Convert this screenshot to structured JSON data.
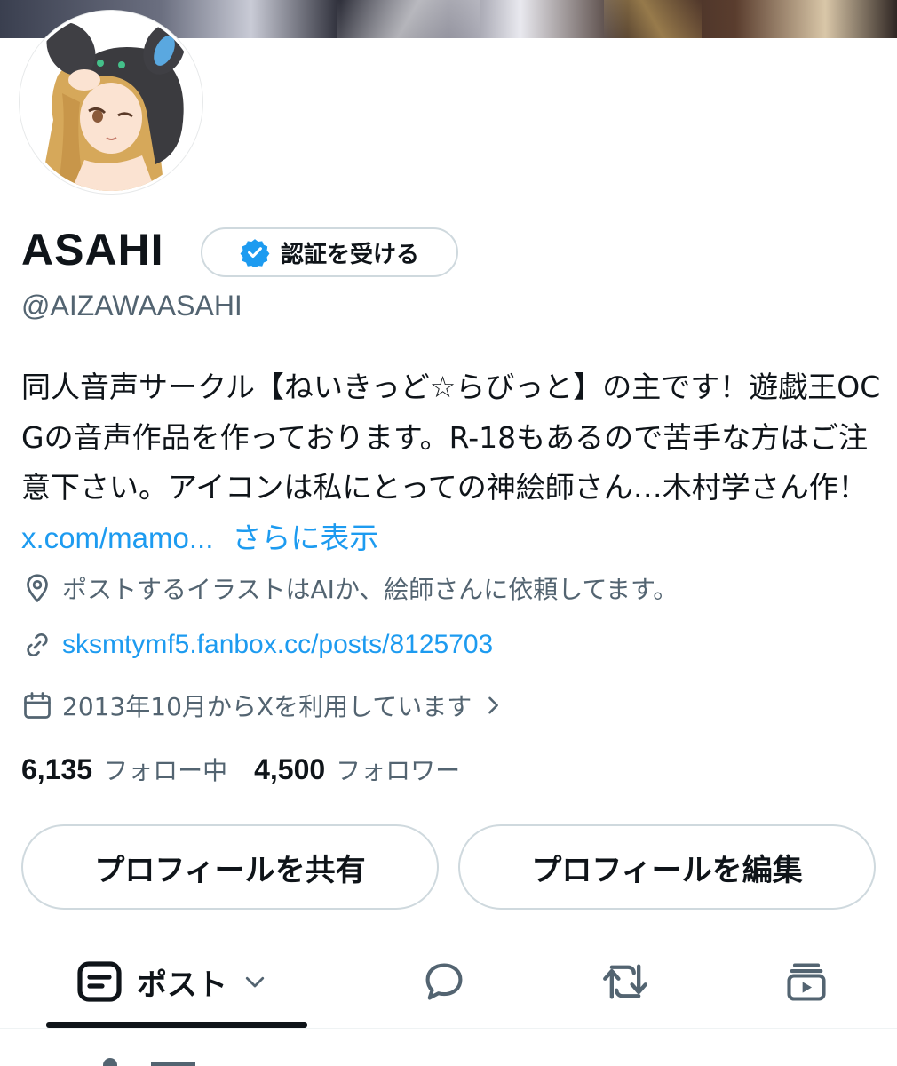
{
  "profile": {
    "name": "ASAHI",
    "handle": "@AIZAWAASAHI",
    "verify_label": "認証を受ける",
    "bio_text": "同人音声サークル【ねいきっど☆らびっと】の主です！遊戯王OCGの音声作品を作っております。R-18もあるので苦手な方はご注意下さい。アイコンは私にとっての神絵師さん…木村学さん作！ ",
    "bio_link": "x.com/mamo...",
    "bio_more": "さらに表示",
    "location": "ポストするイラストはAIか、絵師さんに依頼してます。",
    "website": "sksmtymf5.fanbox.cc/posts/8125703",
    "joined": "2013年10月からXを利用しています",
    "following_count": "6,135",
    "following_label": "フォロー中",
    "followers_count": "4,500",
    "followers_label": "フォロワー"
  },
  "buttons": {
    "share": "プロフィールを共有",
    "edit": "プロフィールを編集"
  },
  "tabs": {
    "posts_label": "ポスト",
    "icons": [
      "posts-icon",
      "replies-icon",
      "reposts-icon",
      "media-icon"
    ]
  },
  "colors": {
    "accent": "#1d9bf0",
    "text": "#0f1419",
    "muted": "#536471",
    "border": "#cfd9de"
  }
}
